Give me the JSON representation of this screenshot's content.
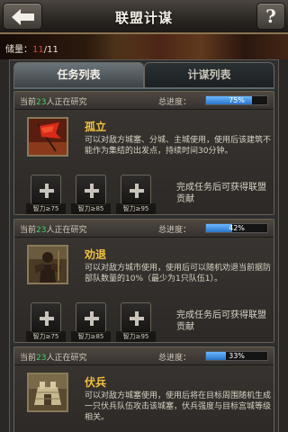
{
  "header": {
    "title": "联盟计谋",
    "help_label": "?"
  },
  "reserve": {
    "label": "储量：",
    "value": "11",
    "max": "/11"
  },
  "tabs": [
    {
      "label": "任务列表",
      "active": true
    },
    {
      "label": "计谋列表",
      "active": false
    }
  ],
  "cards": [
    {
      "researching_prefix": "当前",
      "researching_count": "23",
      "researching_suffix": "人正在研究",
      "progress_label": "总进度：",
      "progress_text": "75%",
      "progress_value": 75,
      "name": "孤立",
      "description": "可以对敌方城塞、分城、主城使用，使用后该建筑不能作为集结的出发点，持续时间30分钟。",
      "icon": "red-flag-icon",
      "requirements": [
        "智力≥75",
        "智力≥85",
        "智力≥95"
      ],
      "reward": "完成任务后可获得联盟贡献"
    },
    {
      "researching_prefix": "当前",
      "researching_count": "23",
      "researching_suffix": "人正在研究",
      "progress_label": "总进度：",
      "progress_text": "42%",
      "progress_value": 42,
      "name": "劝退",
      "description": "可以对敌方城市使用，使用后可以随机劝退当前据防部队数量的10%（最少为1只队伍1）。",
      "icon": "warrior-icon",
      "requirements": [
        "智力≥75",
        "智力≥85",
        "智力≥95"
      ],
      "reward": "完成任务后可获得联盟贡献"
    },
    {
      "researching_prefix": "当前",
      "researching_count": "23",
      "researching_suffix": "人正在研究",
      "progress_label": "总进度：",
      "progress_text": "33%",
      "progress_value": 33,
      "name": "伏兵",
      "description": "可以对敌方城塞使用，使用后将在目标周围随机生成一只伏兵队伍攻击该城塞，伏兵强度与目标宫城等级相关。",
      "icon": "fortress-icon",
      "requirements": [],
      "reward": ""
    }
  ],
  "colors": {
    "accent": "#f0c040",
    "count_green": "#3fd06a",
    "reserve_red": "#e04040",
    "progress_blue": "#2a74c8"
  }
}
